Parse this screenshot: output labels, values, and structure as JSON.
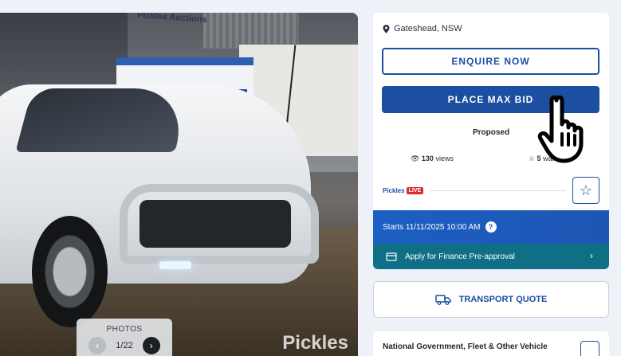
{
  "photo": {
    "sign_text": "Pickles Auctions",
    "watermark": "Pickles",
    "counter_label": "PHOTOS",
    "counter_value": "1/22",
    "prev_icon": "chevron-left-icon",
    "next_icon": "chevron-right-icon"
  },
  "listing": {
    "location": "Gateshead, NSW",
    "enquire_label": "ENQUIRE NOW",
    "bid_label": "PLACE MAX BID",
    "status": "Proposed",
    "views_count": "130",
    "views_label": "views",
    "watchers_count": "5",
    "watchers_label": "watchers",
    "brand": "Pickles",
    "live_badge": "LIVE",
    "starts": "Starts 11/11/2025 10:00 AM",
    "help": "?",
    "finance_label": "Apply for Finance Pre-approval"
  },
  "transport": {
    "label": "TRANSPORT QUOTE"
  },
  "gov": {
    "title": "National Government, Fleet & Other Vehicle"
  },
  "colors": {
    "primary": "#1d4fa0",
    "finance": "#0e6f86",
    "live": "#e02a2a"
  }
}
